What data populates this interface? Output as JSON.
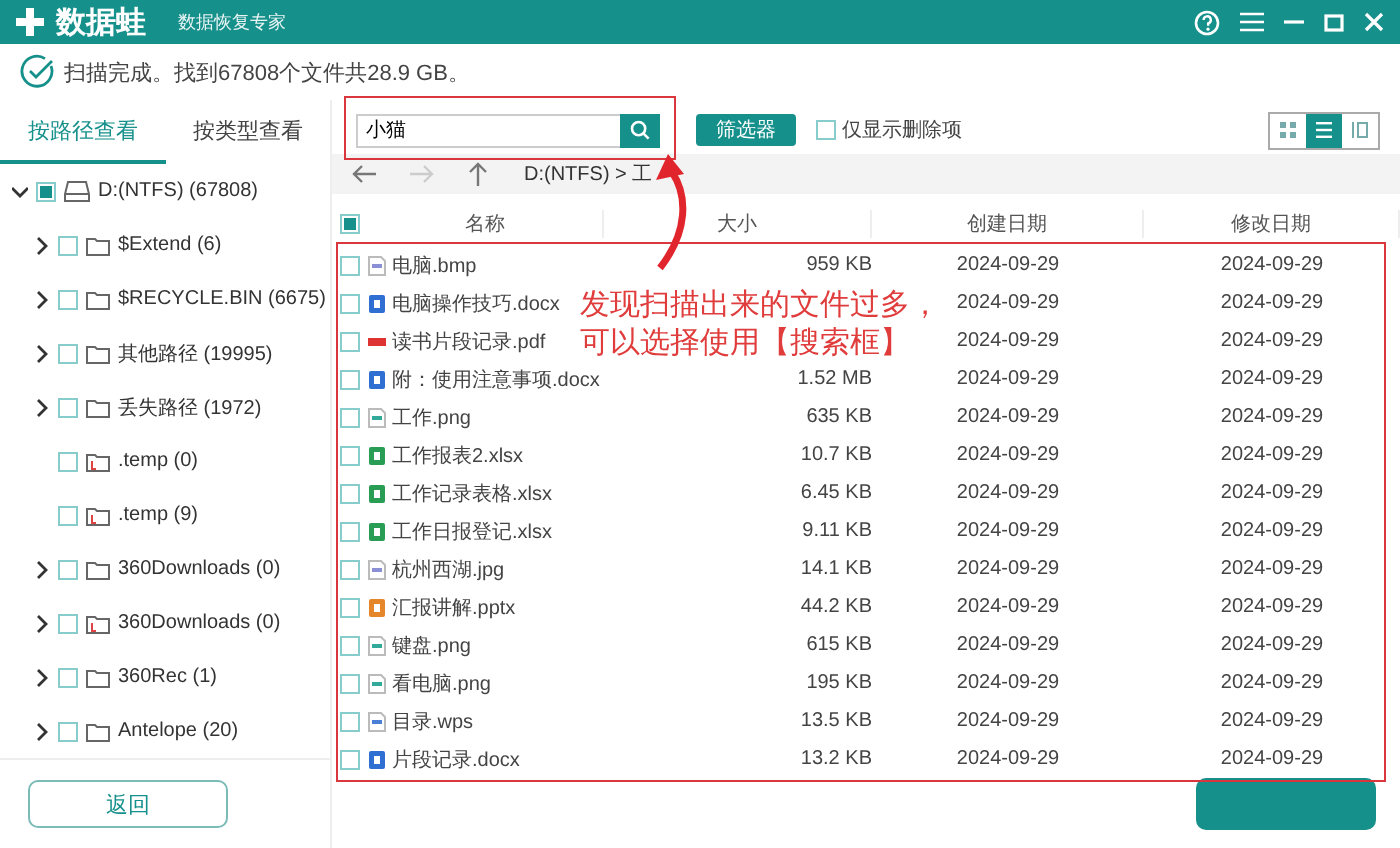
{
  "app": {
    "title": "数据蛙",
    "subtitle": "数据恢复专家"
  },
  "status": "扫描完成。找到67808个文件共28.9 GB。",
  "tabs": [
    {
      "label": "按路径查看",
      "selected": true
    },
    {
      "label": "按类型查看",
      "selected": false
    }
  ],
  "tree": {
    "label": "D:(NTFS) (67808)",
    "partial": true,
    "expanded": true,
    "children": [
      {
        "label": "$Extend (6)",
        "partial": false,
        "expandable": true,
        "kind": "folder"
      },
      {
        "label": "$RECYCLE.BIN (6675)",
        "partial": false,
        "expandable": true,
        "kind": "folder"
      },
      {
        "label": "其他路径 (19995)",
        "partial": false,
        "expandable": true,
        "kind": "folder"
      },
      {
        "label": "丢失路径 (1972)",
        "partial": false,
        "expandable": true,
        "kind": "folder"
      },
      {
        "label": ".temp (0)",
        "partial": false,
        "expandable": false,
        "kind": "marked"
      },
      {
        "label": ".temp (9)",
        "partial": false,
        "expandable": false,
        "kind": "marked"
      },
      {
        "label": "360Downloads (0)",
        "partial": false,
        "expandable": true,
        "kind": "folder"
      },
      {
        "label": "360Downloads (0)",
        "partial": false,
        "expandable": true,
        "kind": "marked"
      },
      {
        "label": "360Rec (1)",
        "partial": false,
        "expandable": true,
        "kind": "folder"
      },
      {
        "label": "Antelope (20)",
        "partial": false,
        "expandable": true,
        "kind": "folder"
      }
    ]
  },
  "search": {
    "value": "小猫"
  },
  "filter_button": "筛选器",
  "deleted_only": {
    "label": "仅显示删除项",
    "checked": false
  },
  "view_modes": [
    {
      "kind": "grid",
      "selected": false
    },
    {
      "kind": "list",
      "selected": true
    },
    {
      "kind": "columns",
      "selected": false
    }
  ],
  "nav": [
    {
      "kind": "back",
      "disabled": false
    },
    {
      "kind": "forward",
      "disabled": true
    },
    {
      "kind": "up",
      "disabled": false
    }
  ],
  "path": "D:(NTFS) > 工",
  "table": {
    "header_partial": true,
    "columns": [
      "名称",
      "大小",
      "创建日期",
      "修改日期"
    ],
    "rows": [
      {
        "name": "电脑.bmp",
        "kind": "image",
        "size": "959 KB",
        "created": "2024-09-29",
        "modified": "2024-09-29",
        "checked": false
      },
      {
        "name": "电脑操作技巧.docx",
        "kind": "doc",
        "created": "2024-09-29",
        "modified": "2024-09-29",
        "checked": false
      },
      {
        "name": "读书片段记录.pdf",
        "kind": "pdf",
        "created": "2024-09-29",
        "modified": "2024-09-29",
        "checked": false
      },
      {
        "name": "附：使用注意事项.docx",
        "kind": "doc",
        "size": "1.52 MB",
        "created": "2024-09-29",
        "modified": "2024-09-29",
        "checked": false
      },
      {
        "name": "工作.png",
        "kind": "png",
        "size": "635 KB",
        "created": "2024-09-29",
        "modified": "2024-09-29",
        "checked": false
      },
      {
        "name": "工作报表2.xlsx",
        "kind": "sheet",
        "size": "10.7 KB",
        "created": "2024-09-29",
        "modified": "2024-09-29",
        "checked": false
      },
      {
        "name": "工作记录表格.xlsx",
        "kind": "sheet",
        "size": "6.45 KB",
        "created": "2024-09-29",
        "modified": "2024-09-29",
        "checked": false
      },
      {
        "name": "工作日报登记.xlsx",
        "kind": "sheet",
        "size": "9.11 KB",
        "created": "2024-09-29",
        "modified": "2024-09-29",
        "checked": false
      },
      {
        "name": "杭州西湖.jpg",
        "kind": "image",
        "size": "14.1 KB",
        "created": "2024-09-29",
        "modified": "2024-09-29",
        "checked": false
      },
      {
        "name": "汇报讲解.pptx",
        "kind": "slides",
        "size": "44.2 KB",
        "created": "2024-09-29",
        "modified": "2024-09-29",
        "checked": false
      },
      {
        "name": "键盘.png",
        "kind": "png",
        "size": "615 KB",
        "created": "2024-09-29",
        "modified": "2024-09-29",
        "checked": false
      },
      {
        "name": "看电脑.png",
        "kind": "png",
        "size": "195 KB",
        "created": "2024-09-29",
        "modified": "2024-09-29",
        "checked": false
      },
      {
        "name": "目录.wps",
        "kind": "wps",
        "size": "13.5 KB",
        "created": "2024-09-29",
        "modified": "2024-09-29",
        "checked": false
      },
      {
        "name": "片段记录.docx",
        "kind": "doc",
        "size": "13.2 KB",
        "created": "2024-09-29",
        "modified": "2024-09-29",
        "checked": false
      }
    ]
  },
  "annotation": {
    "lines": [
      "发现扫描出来的文件过多，",
      "可以选择使用【搜索框】"
    ]
  },
  "back_button": "返回"
}
